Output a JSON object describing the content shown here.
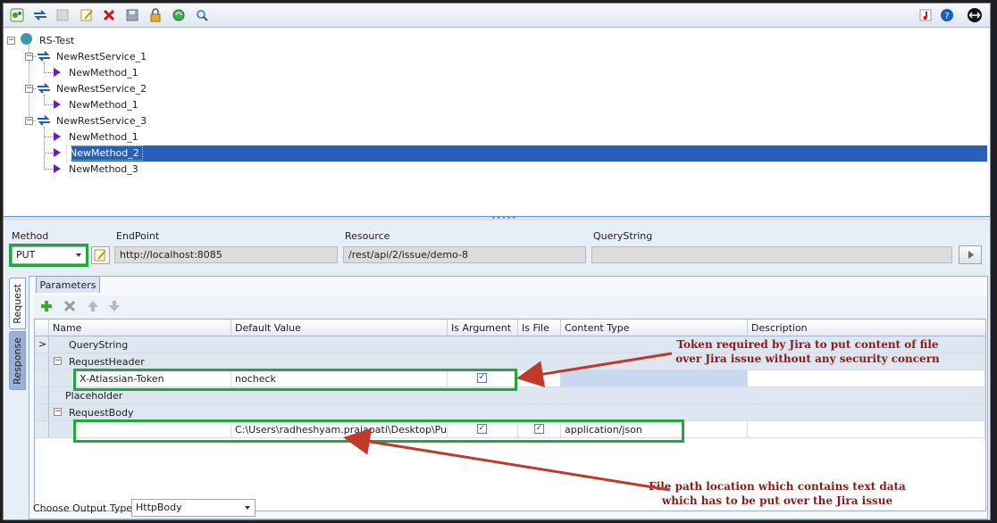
{
  "toolbar": {
    "left_icons": [
      "service-config-icon",
      "refresh-icon",
      "disabled-icon",
      "edit-icon",
      "delete-icon",
      "save-icon",
      "lock-icon",
      "sync-icon",
      "search-icon"
    ],
    "right_icons": [
      "music-note-icon",
      "help-icon",
      "swap-icon"
    ],
    "colors": {
      "delete": "#d01515",
      "sync": "#1c9a2c",
      "help": "#1a5fc0"
    }
  },
  "tree": {
    "root": "RS-Test",
    "services": [
      {
        "name": "NewRestService_1",
        "methods": [
          "NewMethod_1"
        ]
      },
      {
        "name": "NewRestService_2",
        "methods": [
          "NewMethod_1"
        ]
      },
      {
        "name": "NewRestService_3",
        "methods": [
          "NewMethod_1",
          "NewMethod_2",
          "NewMethod_3"
        ]
      }
    ],
    "selected": "NewMethod_2"
  },
  "request": {
    "method_label": "Method",
    "method_value": "PUT",
    "endpoint_label": "EndPoint",
    "endpoint_value": "http://localhost:8085",
    "resource_label": "Resource",
    "resource_value": "/rest/api/2/issue/demo-8",
    "querystring_label": "QueryString",
    "querystring_value": ""
  },
  "side_tabs": {
    "request": "Request",
    "response": "Response"
  },
  "params_tab": "Parameters",
  "grid": {
    "columns": [
      "Name",
      "Default Value",
      "Is Argument",
      "Is File",
      "Content Type",
      "Description"
    ],
    "rows": [
      {
        "type": "group",
        "label": "QueryString",
        "expander": ">"
      },
      {
        "type": "group",
        "label": "RequestHeader",
        "expander": "⊟"
      },
      {
        "type": "data",
        "name": "X-Atlassian-Token",
        "default_value": "nocheck",
        "is_argument": true,
        "is_file": false,
        "content_type": "",
        "description": ""
      },
      {
        "type": "group",
        "label": "Placeholder",
        "expander": ""
      },
      {
        "type": "group",
        "label": "RequestBody",
        "expander": "⊟"
      },
      {
        "type": "data",
        "name": "",
        "default_value": "C:\\Users\\radheshyam.prajapati\\Desktop\\Put.txt",
        "is_argument": true,
        "is_file": true,
        "content_type": "application/json",
        "description": ""
      }
    ]
  },
  "output": {
    "label": "Choose Output Type",
    "value": "HttpBody"
  },
  "annotations": {
    "top_line1": "Token required by Jira to put content of file",
    "top_line2": "over Jira issue without any security concern",
    "bottom_line1": "File path location which contains text data",
    "bottom_line2": "which has to be put over the Jira issue",
    "color": "#8c1a1a",
    "highlight_color": "#20a83a"
  }
}
